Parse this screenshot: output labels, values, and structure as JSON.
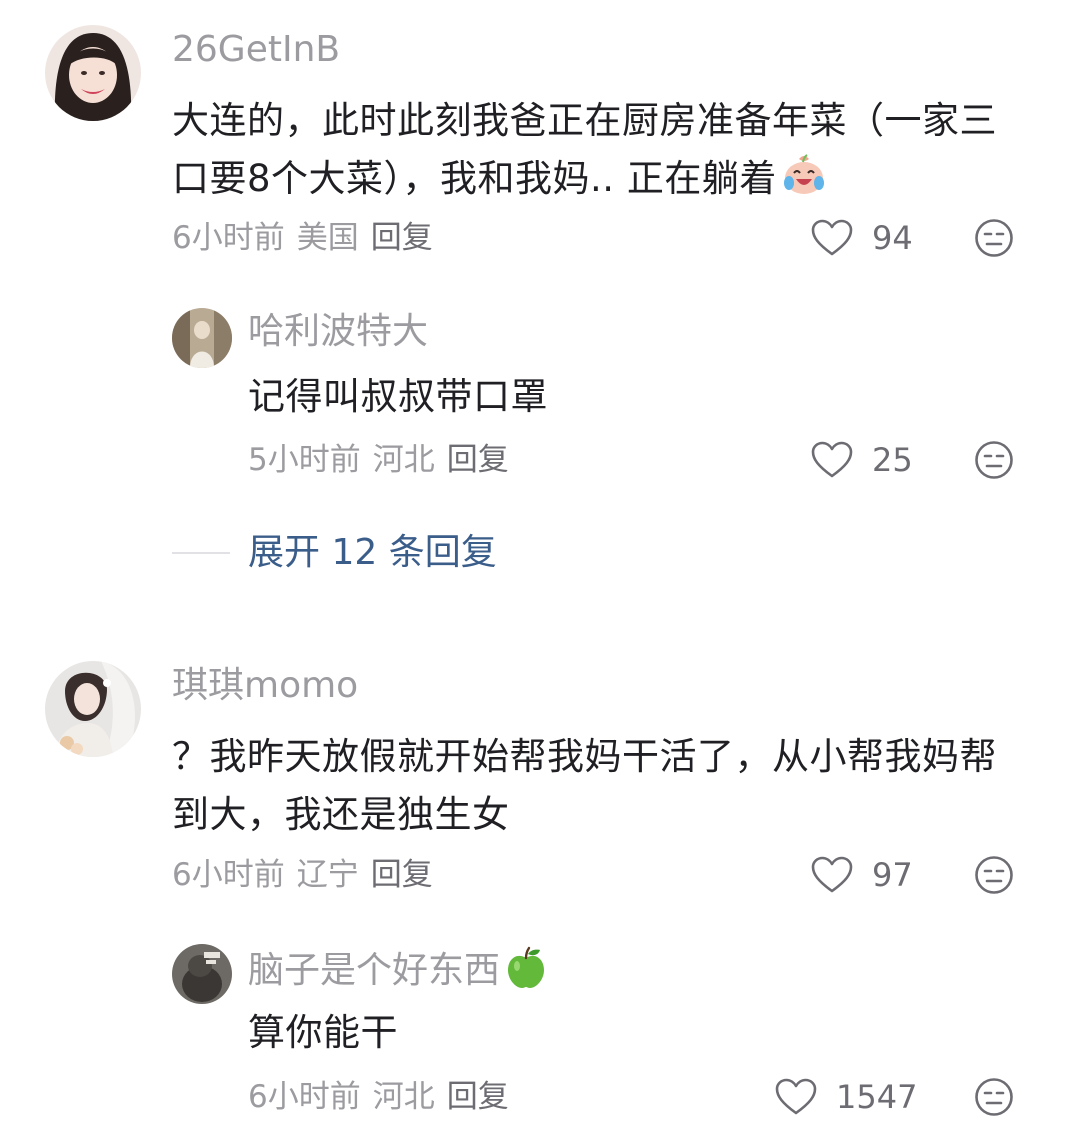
{
  "comments": [
    {
      "username": "26GetInB",
      "content": "大连的，此时此刻我爸正在厨房准备年菜（一家三口要8个大菜），我和我妈.. 正在躺着",
      "content_emoji": "laughing-crying-emoji",
      "time": "6小时前",
      "location": "美国",
      "reply_label": "回复",
      "likes": "94",
      "reply": {
        "username": "哈利波特大",
        "content": "记得叫叔叔带口罩",
        "time": "5小时前",
        "location": "河北",
        "reply_label": "回复",
        "likes": "25"
      },
      "expand_label": "展开 12 条回复"
    },
    {
      "username": "琪琪momo",
      "content": "？我昨天放假就开始帮我妈干活了，从小帮我妈帮到大，我还是独生女",
      "time": "6小时前",
      "location": "辽宁",
      "reply_label": "回复",
      "likes": "97",
      "reply": {
        "username": "脑子是个好东西",
        "username_emoji": "green-apple-emoji",
        "content": "算你能干",
        "time": "6小时前",
        "location": "河北",
        "reply_label": "回复",
        "likes": "1547"
      }
    }
  ],
  "icons": {
    "like": "heart-outline-icon",
    "dislike": "unamused-face-icon"
  },
  "colors": {
    "username": "#9b9ba0",
    "content": "#1f1f24",
    "meta": "#9b9ba0",
    "expand": "#3b5d8a"
  }
}
